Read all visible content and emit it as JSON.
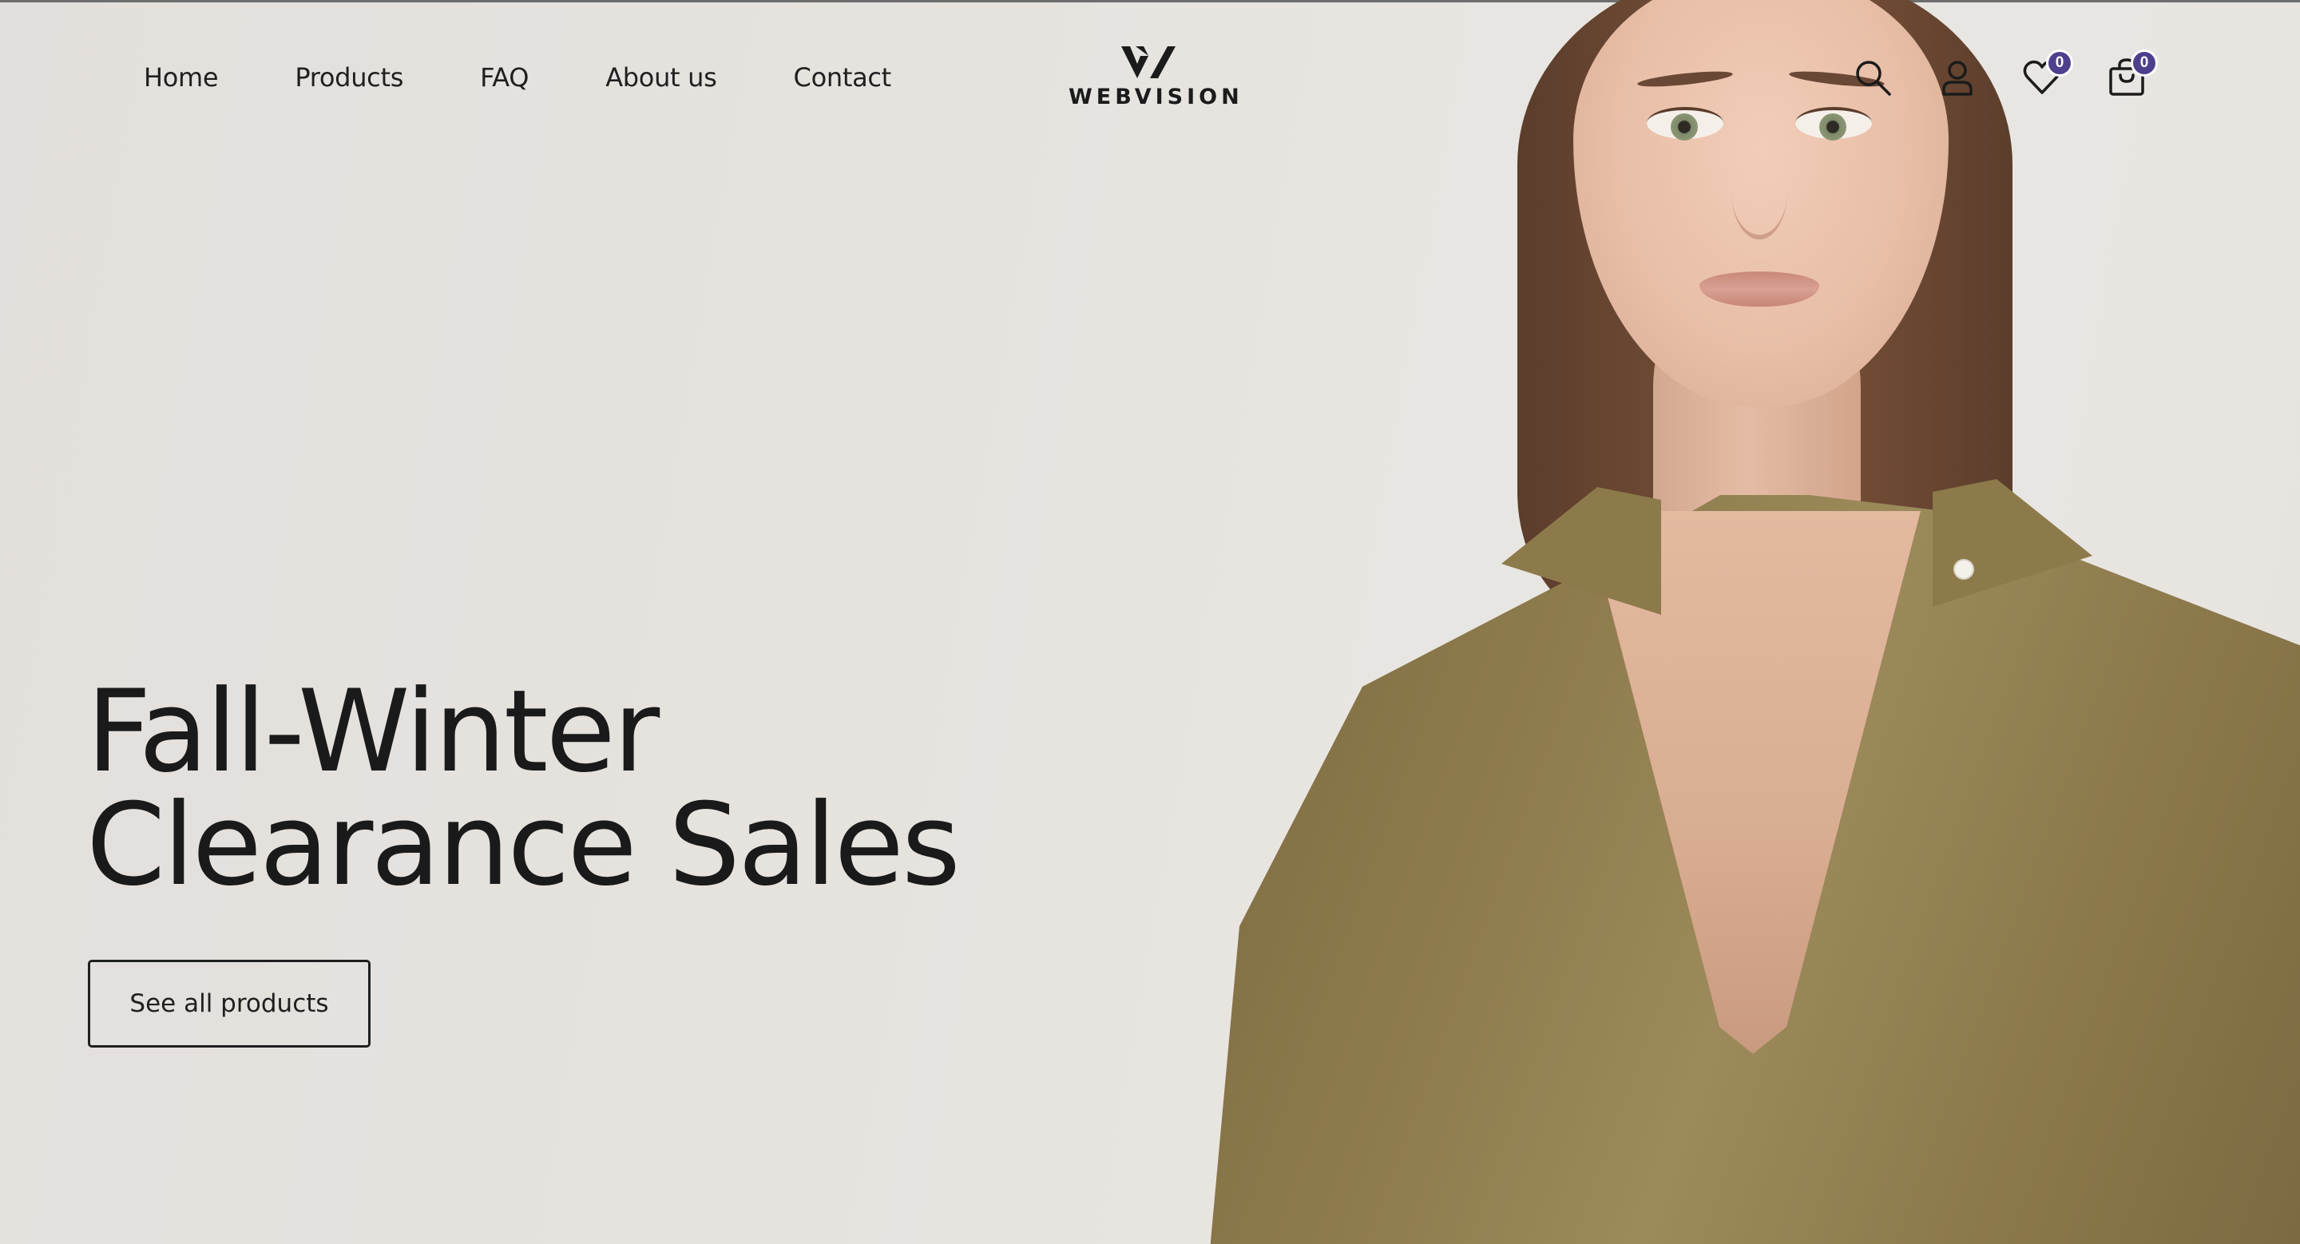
{
  "header": {
    "nav": [
      {
        "label": "Home"
      },
      {
        "label": "Products"
      },
      {
        "label": "FAQ"
      },
      {
        "label": "About us"
      },
      {
        "label": "Contact"
      }
    ],
    "logo": {
      "text": "WEBVISION",
      "icon": "webvision-logo-icon"
    },
    "actions": {
      "search_icon": "search-icon",
      "account_icon": "user-icon",
      "wishlist_icon": "heart-icon",
      "wishlist_count": "0",
      "cart_icon": "shopping-bag-icon",
      "cart_count": "0"
    },
    "badge_color": "#4f3f8c"
  },
  "hero": {
    "title_line1": "Fall-Winter",
    "title_line2": "Clearance Sales",
    "cta_label": "See all products",
    "image": "woman-in-olive-satin-blouse"
  }
}
